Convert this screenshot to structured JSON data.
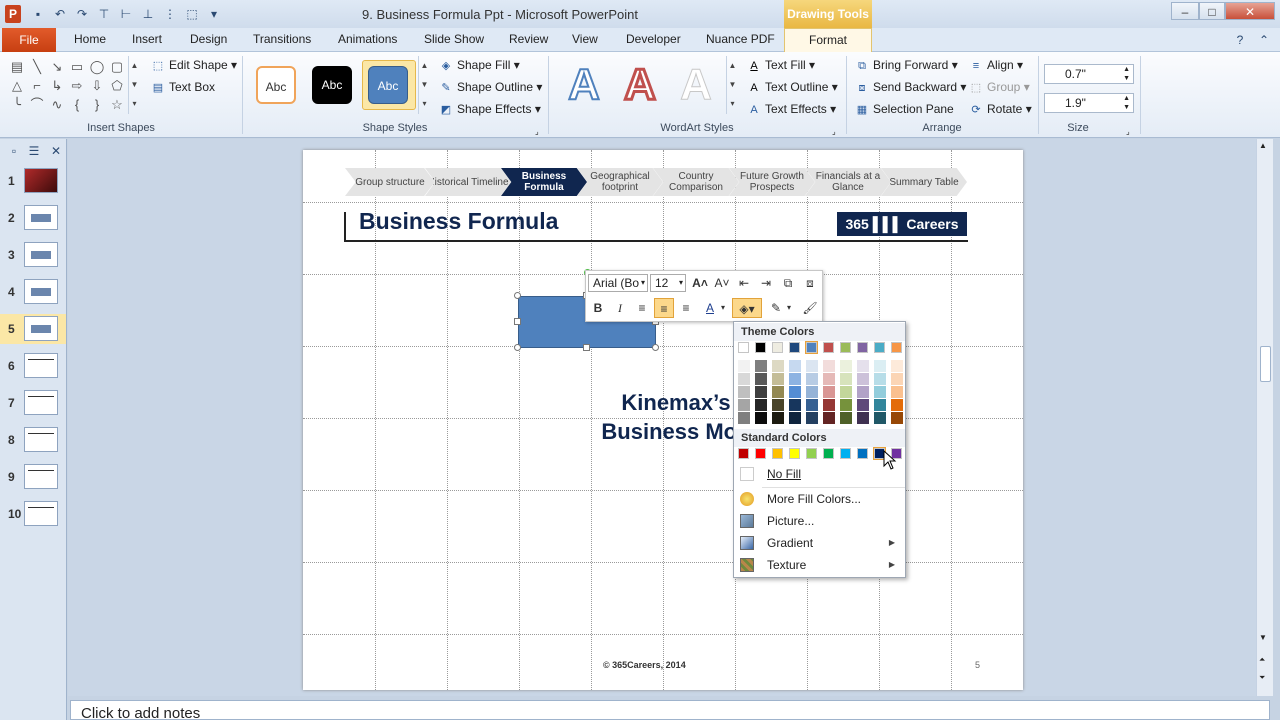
{
  "window": {
    "title": "9. Business Formula Ppt  -  Microsoft PowerPoint",
    "context_tab_group": "Drawing Tools",
    "app_logo": "P"
  },
  "ribbon": {
    "tabs": [
      "Home",
      "Insert",
      "Design",
      "Transitions",
      "Animations",
      "Slide Show",
      "Review",
      "View",
      "Developer",
      "Nuance PDF"
    ],
    "file_tab": "File",
    "active_tab": "Format",
    "groups": {
      "insert_shapes": {
        "label": "Insert Shapes",
        "edit_shape": "Edit Shape",
        "text_box": "Text Box"
      },
      "shape_styles": {
        "label": "Shape Styles",
        "samples": [
          "Abc",
          "Abc",
          "Abc"
        ],
        "shape_fill": "Shape Fill",
        "shape_outline": "Shape Outline",
        "shape_effects": "Shape Effects"
      },
      "wordart_styles": {
        "label": "WordArt Styles",
        "samples": [
          "A",
          "A",
          "A"
        ],
        "text_fill": "Text Fill",
        "text_outline": "Text Outline",
        "text_effects": "Text Effects"
      },
      "arrange": {
        "label": "Arrange",
        "bring_forward": "Bring Forward",
        "send_backward": "Send Backward",
        "selection_pane": "Selection Pane",
        "align": "Align",
        "group": "Group",
        "rotate": "Rotate"
      },
      "size": {
        "label": "Size",
        "height": "0.7\"",
        "width": "1.9\""
      }
    }
  },
  "slides_panel": {
    "numbers": [
      "1",
      "2",
      "3",
      "4",
      "5",
      "6",
      "7",
      "8",
      "9",
      "10"
    ],
    "active": "5"
  },
  "slide": {
    "nav_steps": [
      "Group structure",
      "Historical Timeline",
      "Business Formula",
      "Geographical footprint",
      "Country Comparison",
      "Future Growth Prospects",
      "Financials at a Glance",
      "Summary Table"
    ],
    "active_step": "Business Formula",
    "title": "Business Formula",
    "logo_text": "365 ▌▌▌ Careers",
    "subtitle_line1": "Kinemax’s",
    "subtitle_line2": "Business Mod",
    "footer": "© 365Careers, 2014",
    "number": "5"
  },
  "mini_toolbar": {
    "font": "Arial (Bo",
    "size": "12"
  },
  "fill_menu": {
    "theme_colors_label": "Theme Colors",
    "standard_colors_label": "Standard Colors",
    "theme_top_row": [
      "#ffffff",
      "#000000",
      "#eeece1",
      "#1f497d",
      "#4f81bd",
      "#c0504d",
      "#9bbb59",
      "#8064a2",
      "#4bacc6",
      "#f79646"
    ],
    "theme_shades": [
      [
        "#f2f2f2",
        "#7f7f7f",
        "#ddd9c3",
        "#c6d9f0",
        "#dbe5f1",
        "#f2dcdb",
        "#ebf1dd",
        "#e5e0ec",
        "#dbeef3",
        "#fdeada"
      ],
      [
        "#d8d8d8",
        "#595959",
        "#c4bd97",
        "#8db3e2",
        "#b8cce4",
        "#e5b9b7",
        "#d7e3bc",
        "#ccc1d9",
        "#b7dde8",
        "#fbd5b5"
      ],
      [
        "#bfbfbf",
        "#3f3f3f",
        "#938953",
        "#548dd4",
        "#95b3d7",
        "#d99694",
        "#c3d69b",
        "#b2a2c7",
        "#92cddc",
        "#fac08f"
      ],
      [
        "#a5a5a5",
        "#262626",
        "#494429",
        "#17365d",
        "#366092",
        "#953734",
        "#76923c",
        "#5f497a",
        "#31859b",
        "#e36c09"
      ],
      [
        "#7f7f7f",
        "#0c0c0c",
        "#1d1b10",
        "#0f243e",
        "#244061",
        "#632423",
        "#4f6128",
        "#3f3151",
        "#205867",
        "#974806"
      ]
    ],
    "standard_colors": [
      "#c00000",
      "#ff0000",
      "#ffc000",
      "#ffff00",
      "#92d050",
      "#00b050",
      "#00b0f0",
      "#0070c0",
      "#002060",
      "#7030a0"
    ],
    "no_fill": "No Fill",
    "more_fill_colors": "More Fill Colors...",
    "picture": "Picture...",
    "gradient": "Gradient",
    "texture": "Texture"
  },
  "notes_placeholder": "Click to add notes"
}
